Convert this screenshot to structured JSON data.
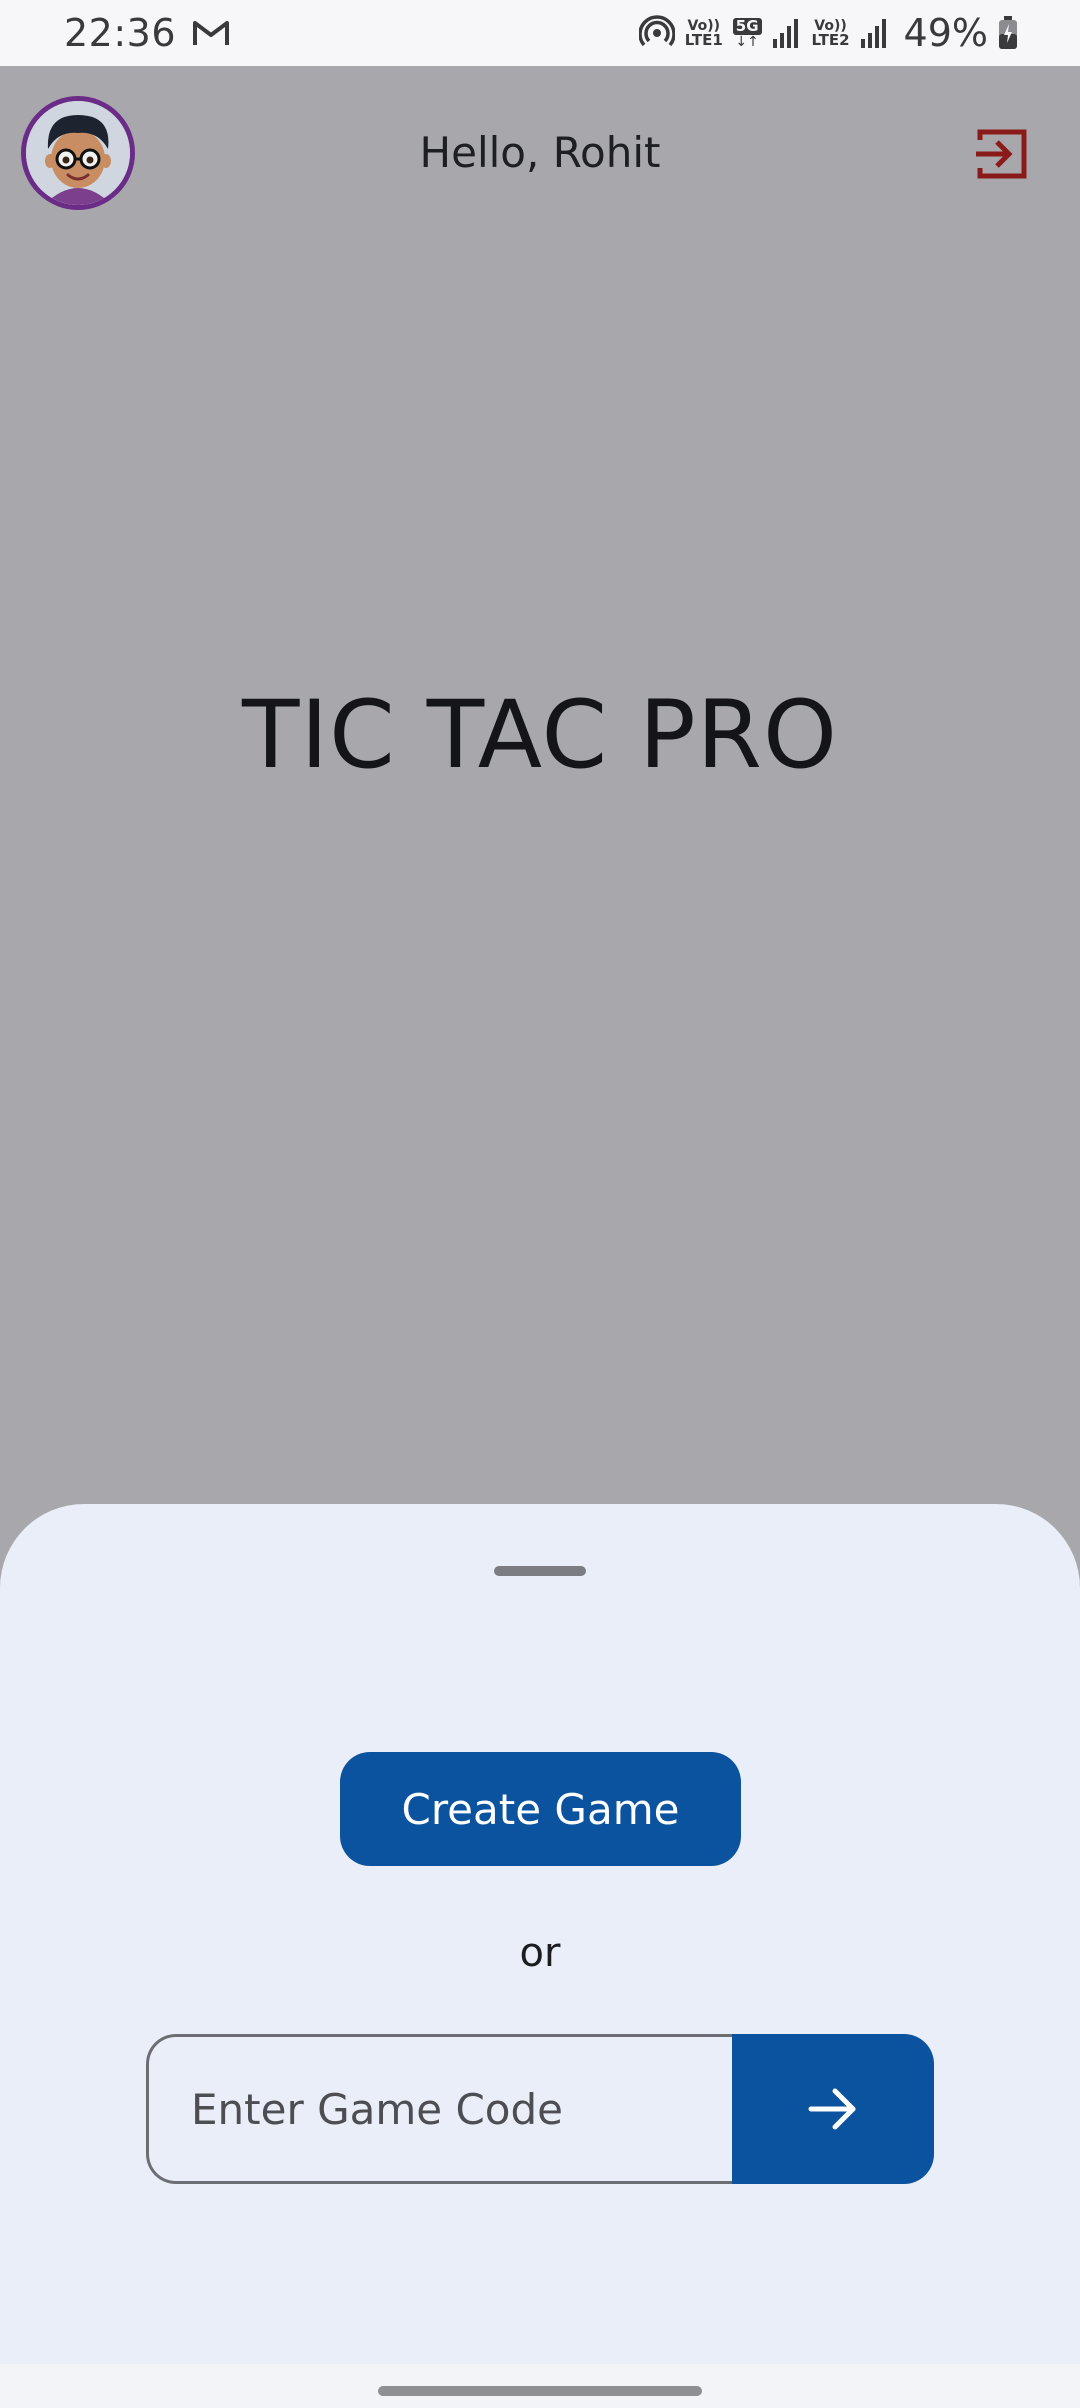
{
  "status_bar": {
    "time": "22:36",
    "network_1": "Vo)) LTE1",
    "network_1_top": "Vo))",
    "network_1_bottom": "LTE1",
    "network_gen": "5G",
    "network_2_top": "Vo))",
    "network_2_bottom": "LTE2",
    "battery_percent": "49%",
    "icons": [
      "gmail-icon",
      "hotspot-icon",
      "signal-icon",
      "battery-icon"
    ]
  },
  "header": {
    "greeting": "Hello, Rohit",
    "logout_icon": "logout-icon"
  },
  "main": {
    "title": "TIC TAC PRO"
  },
  "sheet": {
    "create_label": "Create Game",
    "or_label": "or",
    "code_placeholder": "Enter Game Code",
    "code_value": "",
    "submit_icon": "arrow-right-icon"
  },
  "colors": {
    "primary": "#0b529f",
    "logout": "#8b1a1a",
    "scrim_background": "#a8a8ac",
    "sheet_background": "#eaeef8",
    "avatar_ring": "#6a2c86"
  }
}
